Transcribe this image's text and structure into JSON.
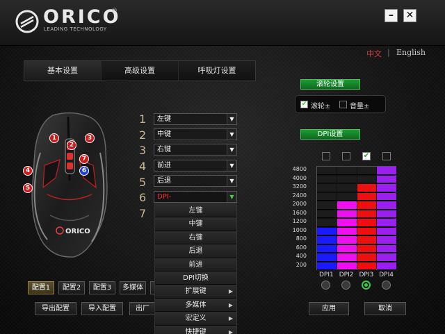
{
  "app": {
    "brand": "ORICO",
    "brand_reg": "®",
    "tagline": "LEADING TECHNOLOGY",
    "min_label": "–",
    "close_label": "✕"
  },
  "language": {
    "zh": "中文",
    "sep": "|",
    "en": "English"
  },
  "tabs": [
    {
      "label": "基本设置",
      "active": true
    },
    {
      "label": "高级设置",
      "active": false
    },
    {
      "label": "呼吸灯设置",
      "active": false
    }
  ],
  "mouse_markers": [
    "1",
    "2",
    "3",
    "4",
    "5",
    "6",
    "7"
  ],
  "button_rows": [
    {
      "num": "1",
      "value": "左键"
    },
    {
      "num": "2",
      "value": "中键"
    },
    {
      "num": "3",
      "value": "右键"
    },
    {
      "num": "4",
      "value": "前进"
    },
    {
      "num": "5",
      "value": "后退"
    },
    {
      "num": "6",
      "value": "DPI-"
    },
    {
      "num": "7",
      "value": ""
    }
  ],
  "dropdown_arrow": "▼",
  "menu": [
    {
      "label": "左键",
      "sub": ""
    },
    {
      "label": "中键",
      "sub": ""
    },
    {
      "label": "右键",
      "sub": ""
    },
    {
      "label": "后退",
      "sub": ""
    },
    {
      "label": "前进",
      "sub": ""
    },
    {
      "label": "DPI切换",
      "sub": ""
    },
    {
      "label": "扩展键",
      "sub": "▶"
    },
    {
      "label": "多媒体",
      "sub": "▶"
    },
    {
      "label": "宏定义",
      "sub": "▶"
    },
    {
      "label": "快捷键",
      "sub": "▶"
    }
  ],
  "wheel": {
    "button_label": "滚轮设置",
    "wheel_label": "滚轮±",
    "wheel_checked": true,
    "volume_label": "音量±",
    "volume_checked": false
  },
  "dpi": {
    "button_label": "DPI设置",
    "enabled": [
      false,
      false,
      true,
      false
    ],
    "levels": [
      "4800",
      "4000",
      "3200",
      "2400",
      "2000",
      "1600",
      "1200",
      "1000",
      "800",
      "600",
      "400",
      "200"
    ],
    "columns": [
      {
        "label": "DPI1",
        "level": "1000",
        "color": "#1a1aff"
      },
      {
        "label": "DPI2",
        "level": "2000",
        "color": "#ee10ee"
      },
      {
        "label": "DPI3",
        "level": "3200",
        "color": "#ee1010"
      },
      {
        "label": "DPI4",
        "level": "4800",
        "color": "#9a20f0"
      }
    ],
    "selected_index": 2
  },
  "profiles": [
    {
      "label": "配置1",
      "active": true
    },
    {
      "label": "配置2",
      "active": false
    },
    {
      "label": "配置3",
      "active": false
    },
    {
      "label": "多媒体",
      "active": false
    },
    {
      "label": "",
      "active": false
    }
  ],
  "actions": {
    "export_label": "导出配置",
    "import_label": "导入配置",
    "factory_label": "出厂设",
    "apply_label": "应用",
    "cancel_label": "取消"
  },
  "colors": {
    "accent_green": "#1f9a35",
    "marker_red": "#d01818",
    "marker_blue": "#2040d0"
  }
}
